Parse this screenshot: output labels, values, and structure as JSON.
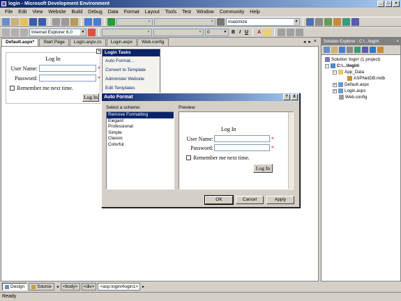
{
  "window": {
    "title": "login - Microsoft Development Environment"
  },
  "menu": [
    "File",
    "Edit",
    "View",
    "Website",
    "Build",
    "Debug",
    "Data",
    "Format",
    "Layout",
    "Tools",
    "Test",
    "Window",
    "Community",
    "Help"
  ],
  "toolbar": {
    "zoom_combo_value": "maximize",
    "browser_combo_value": "Internet Explorer 6.0",
    "fontsize_combo_value": "0",
    "bold": "B",
    "italic": "I",
    "underline": "U",
    "font_color": "A"
  },
  "doc_tabs": [
    "Default.aspx*",
    "Start Page",
    "Login.aspx.cs",
    "Login.aspx",
    "Web.config"
  ],
  "login_control": {
    "title": "Log In",
    "username_label": "User Name:",
    "password_label": "Password:",
    "remember_label": "Remember me next time.",
    "button_label": "Log In",
    "required_marker": "*"
  },
  "tasks": {
    "title": "Login Tasks",
    "items": [
      "Auto Format...",
      "Convert to Template",
      "Administer Website",
      "Edit Templates"
    ]
  },
  "dialog": {
    "title": "Auto Format",
    "scheme_label": "Select a scheme:",
    "preview_label": "Preview:",
    "schemes": [
      "Remove Formatting",
      "Elegant",
      "Professional",
      "Simple",
      "Classic",
      "Colorful"
    ],
    "selected_scheme": "Remove Formatting",
    "ok": "OK",
    "cancel": "Cancel",
    "apply": "Apply",
    "help_btn": "?",
    "close_btn": "X"
  },
  "solution_explorer": {
    "title": "Solution Explorer - C:\\...\\login\\",
    "items": [
      {
        "label": "Solution 'login' (1 project)",
        "icon": "solution-icon"
      },
      {
        "label": "C:\\...\\login\\",
        "icon": "website-icon"
      },
      {
        "label": "App_Data",
        "icon": "folder-icon"
      },
      {
        "label": "ASPNetDB.mdb",
        "icon": "database-icon"
      },
      {
        "label": "Default.aspx",
        "icon": "aspx-file-icon"
      },
      {
        "label": "Login.aspx",
        "icon": "aspx-file-icon"
      },
      {
        "label": "Web.config",
        "icon": "config-file-icon"
      }
    ]
  },
  "view_buttons": {
    "design": "Design",
    "source": "Source"
  },
  "breadcrumbs": [
    "<body>",
    "<div>",
    "<asp:login#login1>"
  ],
  "status": {
    "text": "Ready"
  },
  "colors": {
    "titlebar": "#0a246a",
    "selection": "#0a246a",
    "required": "#d00000",
    "link": "#0a246a"
  }
}
